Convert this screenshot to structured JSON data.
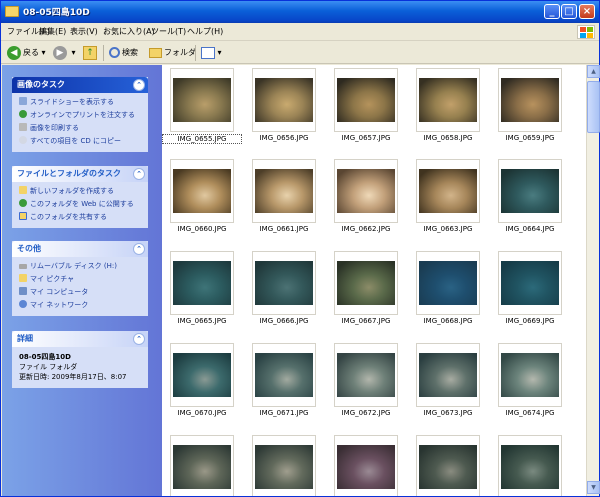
{
  "window": {
    "title": "08-05四島10D"
  },
  "menu": [
    "ファイル(F)",
    "編集(E)",
    "表示(V)",
    "お気に入り(A)",
    "ツール(T)",
    "ヘルプ(H)"
  ],
  "toolbar": {
    "back": "戻る",
    "search": "検索",
    "folders": "フォルダ"
  },
  "panels": {
    "image_tasks": {
      "title": "画像のタスク",
      "items": [
        "スライドショーを表示する",
        "オンラインでプリントを注文する",
        "画像を印刷する",
        "すべての項目を CD にコピー"
      ]
    },
    "file_folder_tasks": {
      "title": "ファイルとフォルダのタスク",
      "items": [
        "新しいフォルダを作成する",
        "このフォルダを Web に公開する",
        "このフォルダを共有する"
      ]
    },
    "other_places": {
      "title": "その他",
      "items": [
        "リムーバブル ディスク (H:)",
        "マイ ピクチャ",
        "マイ コンピュータ",
        "マイ ネットワーク"
      ]
    },
    "details": {
      "title": "詳細",
      "name": "08-05四島10D",
      "type": "ファイル フォルダ",
      "modified": "更新日時: 2009年8月17日、8:07"
    }
  },
  "files": [
    "IMG_0655.JPG",
    "IMG_0656.JPG",
    "IMG_0657.JPG",
    "IMG_0658.JPG",
    "IMG_0659.JPG",
    "IMG_0660.JPG",
    "IMG_0661.JPG",
    "IMG_0662.JPG",
    "IMG_0663.JPG",
    "IMG_0664.JPG",
    "IMG_0665.JPG",
    "IMG_0666.JPG",
    "IMG_0667.JPG",
    "IMG_0668.JPG",
    "IMG_0669.JPG",
    "IMG_0670.JPG",
    "IMG_0671.JPG",
    "IMG_0672.JPG",
    "IMG_0673.JPG",
    "IMG_0674.JPG",
    "",
    "",
    "",
    "",
    ""
  ],
  "selected_file": "IMG_0655.JPG",
  "colors": {
    "title_bar": "#0a5fd8",
    "task_pane": "#6d8fe0"
  }
}
